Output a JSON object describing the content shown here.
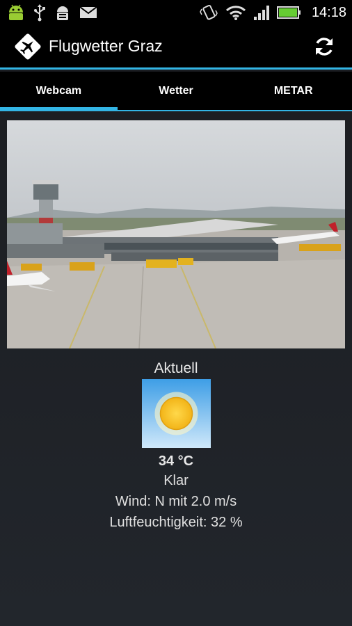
{
  "status_bar": {
    "time": "14:18"
  },
  "action_bar": {
    "title": "Flugwetter Graz"
  },
  "tabs": [
    {
      "label": "Webcam",
      "active": true
    },
    {
      "label": "Wetter",
      "active": false
    },
    {
      "label": "METAR",
      "active": false
    }
  ],
  "weather": {
    "heading": "Aktuell",
    "condition_icon": "sun-icon",
    "temperature": "34 °C",
    "condition": "Klar",
    "wind": "Wind: N mit 2.0 m/s",
    "humidity": "Luftfeuchtigkeit: 32 %"
  },
  "colors": {
    "accent": "#33b5e5",
    "background": "#1e2126",
    "bar": "#000000"
  }
}
